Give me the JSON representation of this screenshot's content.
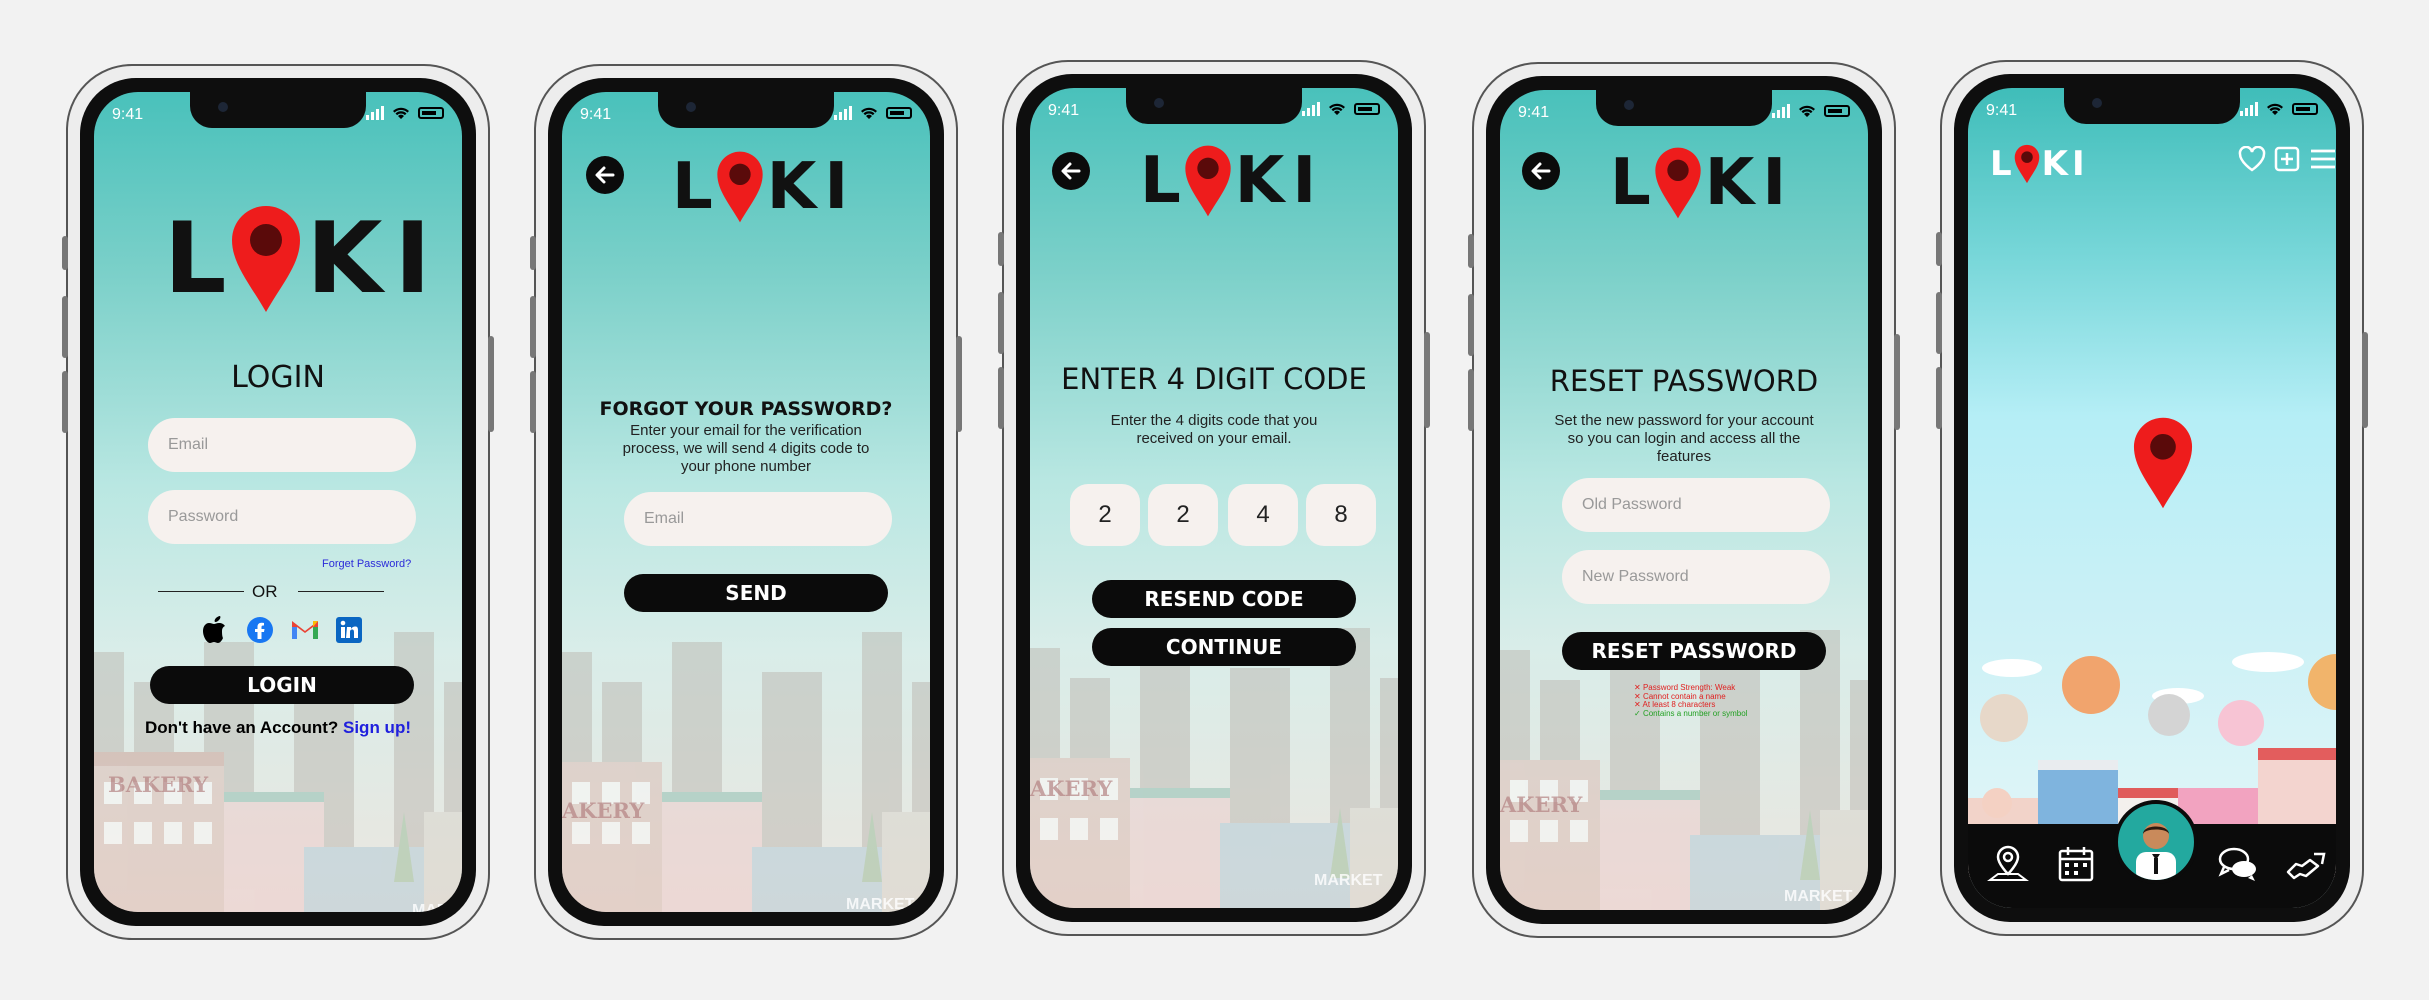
{
  "status_time": "9:41",
  "brand": {
    "letters": [
      "L",
      "K",
      "I"
    ],
    "pin_color": "#ee1c1c",
    "accent": "#45c1bb"
  },
  "login": {
    "title": "LOGIN",
    "email_placeholder": "Email",
    "password_placeholder": "Password",
    "forgot_link": "Forget Password?",
    "or_label": "OR",
    "social_icons": [
      "apple-icon",
      "facebook-icon",
      "gmail-icon",
      "linkedin-icon"
    ],
    "login_button": "LOGIN",
    "signup_prompt": "Don't have an Account?",
    "signup_link": "Sign up!"
  },
  "forgot": {
    "title": "FORGOT YOUR PASSWORD?",
    "subtitle": "Enter your email for the verification process, we will send 4 digits code to your phone number",
    "email_placeholder": "Email",
    "send_button": "SEND"
  },
  "verify": {
    "title": "ENTER 4 DIGIT CODE",
    "subtitle": "Enter the 4 digits code that you received on your email.",
    "digits": [
      "2",
      "2",
      "4",
      "8"
    ],
    "resend_button": "RESEND CODE",
    "continue_button": "CONTINUE"
  },
  "reset": {
    "title": "RESET PASSWORD",
    "subtitle": "Set the new password for your account so you can login and access all the features",
    "old_placeholder": "Old Password",
    "new_placeholder": "New Password",
    "reset_button": "RESET PASSWORD",
    "rules": [
      {
        "text": "Password Strength: Weak",
        "status": "fail"
      },
      {
        "text": "Cannot contain a name",
        "status": "fail"
      },
      {
        "text": "At least 8 characters",
        "status": "fail"
      },
      {
        "text": "Contains a number or symbol",
        "status": "pass"
      }
    ]
  },
  "home": {
    "header_icons": [
      "heart-icon",
      "add-icon",
      "menu-icon"
    ],
    "nav_icons": [
      "map-pin-icon",
      "calendar-icon",
      "profile-avatar",
      "chat-icon",
      "handshake-icon"
    ]
  },
  "city_labels": {
    "bakery": "BAKERY",
    "market": "MARKET"
  }
}
